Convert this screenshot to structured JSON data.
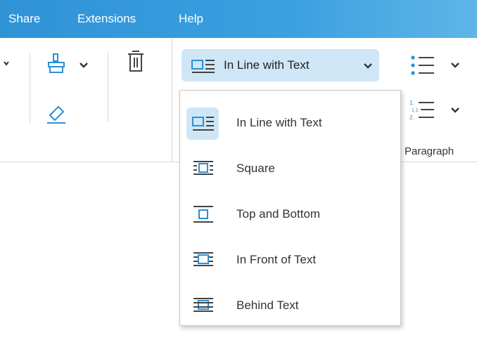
{
  "menubar": {
    "items": [
      "Share",
      "Extensions",
      "Help"
    ]
  },
  "ribbon": {
    "wrap_button_label": "In Line with Text",
    "paragraph_group_label": "Paragraph"
  },
  "wrap_menu": {
    "items": [
      {
        "label": "In Line with Text",
        "selected": true,
        "icon": "wrap-inline-icon"
      },
      {
        "label": "Square",
        "selected": false,
        "icon": "wrap-square-icon"
      },
      {
        "label": "Top and Bottom",
        "selected": false,
        "icon": "wrap-top-bottom-icon"
      },
      {
        "label": "In Front of Text",
        "selected": false,
        "icon": "wrap-in-front-icon"
      },
      {
        "label": "Behind Text",
        "selected": false,
        "icon": "wrap-behind-icon"
      }
    ]
  },
  "colors": {
    "accent": "#2b8fd6",
    "menubar": "#3aa0e0",
    "selected_bg": "#cfe6f7"
  }
}
